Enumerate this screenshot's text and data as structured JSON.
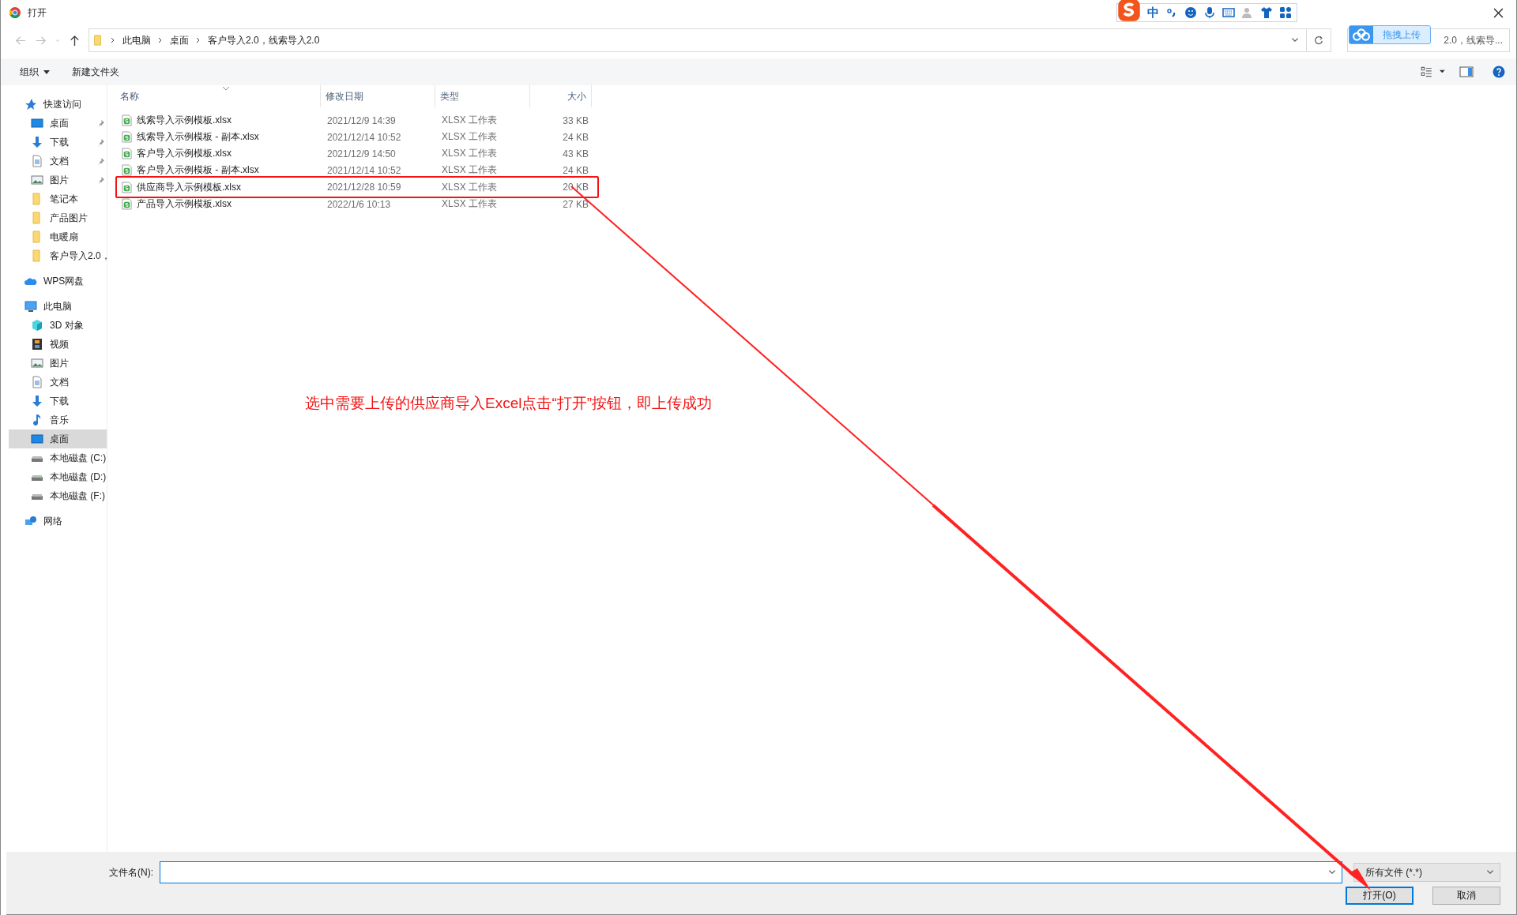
{
  "window": {
    "title": "打开"
  },
  "ime_toolbar": {
    "mode": "中"
  },
  "address_bar": {
    "path": [
      "此电脑",
      "桌面",
      "客户导入2.0，线索导入2.0"
    ]
  },
  "search": {
    "value": "2.0，线索导..."
  },
  "upload_badge": {
    "label": "拖拽上传"
  },
  "toolbar": {
    "organize": "组织",
    "new_folder": "新建文件夹"
  },
  "sidebar": [
    {
      "label": "快速访问",
      "kind": "star",
      "selected": false,
      "children": [
        {
          "label": "桌面",
          "kind": "desktop",
          "pinned": true,
          "selected": false
        },
        {
          "label": "下载",
          "kind": "download",
          "pinned": true,
          "selected": false
        },
        {
          "label": "文档",
          "kind": "document",
          "pinned": true,
          "selected": false
        },
        {
          "label": "图片",
          "kind": "image",
          "pinned": true,
          "selected": false
        },
        {
          "label": "笔记本",
          "kind": "folder",
          "pinned": false,
          "selected": false
        },
        {
          "label": "产品图片",
          "kind": "folder",
          "pinned": false,
          "selected": false
        },
        {
          "label": "电暖扇",
          "kind": "folder",
          "pinned": false,
          "selected": false
        },
        {
          "label": "客户导入2.0，",
          "kind": "folder",
          "pinned": false,
          "selected": false
        }
      ]
    },
    {
      "label": "WPS网盘",
      "kind": "cloud",
      "selected": false
    },
    {
      "label": "此电脑",
      "kind": "computer",
      "selected": false,
      "children": [
        {
          "label": "3D 对象",
          "kind": "cube",
          "pinned": false,
          "selected": false
        },
        {
          "label": "视频",
          "kind": "video",
          "pinned": false,
          "selected": false
        },
        {
          "label": "图片",
          "kind": "image",
          "pinned": false,
          "selected": false
        },
        {
          "label": "文档",
          "kind": "document",
          "pinned": false,
          "selected": false
        },
        {
          "label": "下载",
          "kind": "download",
          "pinned": false,
          "selected": false
        },
        {
          "label": "音乐",
          "kind": "music",
          "pinned": false,
          "selected": false
        },
        {
          "label": "桌面",
          "kind": "desktop",
          "pinned": false,
          "selected": true
        },
        {
          "label": "本地磁盘 (C:)",
          "kind": "drive",
          "pinned": false,
          "selected": false
        },
        {
          "label": "本地磁盘 (D:)",
          "kind": "drive",
          "pinned": false,
          "selected": false
        },
        {
          "label": "本地磁盘 (F:)",
          "kind": "drive",
          "pinned": false,
          "selected": false
        }
      ]
    },
    {
      "label": "网络",
      "kind": "network",
      "selected": false
    }
  ],
  "columns": [
    "名称",
    "修改日期",
    "类型",
    "大小"
  ],
  "files": [
    {
      "name": "线索导入示例模板.xlsx",
      "modified": "2021/12/9 14:39",
      "type": "XLSX 工作表",
      "size": "33 KB",
      "annotated": false
    },
    {
      "name": "线索导入示例模板 - 副本.xlsx",
      "modified": "2021/12/14 10:52",
      "type": "XLSX 工作表",
      "size": "24 KB",
      "annotated": false
    },
    {
      "name": "客户导入示例模板.xlsx",
      "modified": "2021/12/9 14:50",
      "type": "XLSX 工作表",
      "size": "43 KB",
      "annotated": false
    },
    {
      "name": "客户导入示例模板 - 副本.xlsx",
      "modified": "2021/12/14 10:52",
      "type": "XLSX 工作表",
      "size": "24 KB",
      "annotated": false
    },
    {
      "name": "供应商导入示例模板.xlsx",
      "modified": "2021/12/28 10:59",
      "type": "XLSX 工作表",
      "size": "20 KB",
      "annotated": true
    },
    {
      "name": "产品导入示例模板.xlsx",
      "modified": "2022/1/6 10:13",
      "type": "XLSX 工作表",
      "size": "27 KB",
      "annotated": false
    }
  ],
  "annotation": "选中需要上传的供应商导入Excel点击“打开”按钮，即上传成功",
  "file_name": {
    "label": "文件名(N):"
  },
  "file_type": {
    "value": "所有文件 (*.*)"
  },
  "buttons": [
    {
      "label": "打开(O)",
      "default": true
    },
    {
      "label": "取消",
      "default": false
    }
  ]
}
